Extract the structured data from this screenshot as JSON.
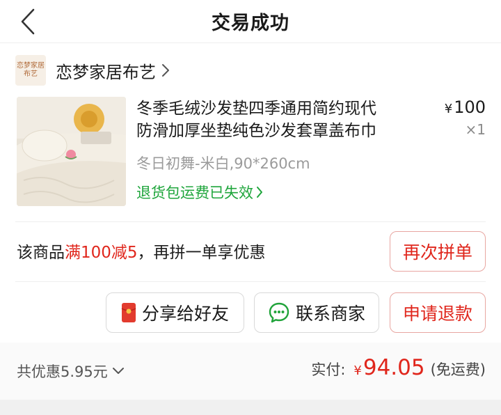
{
  "header": {
    "title": "交易成功",
    "back_icon": "chevron-left-icon"
  },
  "shop": {
    "logo_text": "恋梦家居布艺",
    "name": "恋梦家居布艺",
    "chevron_icon": "chevron-right-icon"
  },
  "product": {
    "title_line1": "冬季毛绒沙发垫四季通用简约现代",
    "title_line2": "防滑加厚坐垫纯色沙发套罩盖布巾",
    "price_symbol": "¥",
    "price": "100",
    "quantity": "×1",
    "sku": "冬日初舞-米白,90*260cm",
    "return_status": "退货包运费已失效"
  },
  "promo": {
    "prefix": "该商品",
    "highlight": "满100减5",
    "suffix": "，再拼一单享优惠",
    "button_label": "再次拼单"
  },
  "actions": {
    "share_label": "分享给好友",
    "share_icon": "red-envelope-icon",
    "contact_label": "联系商家",
    "contact_icon": "chat-bubble-icon",
    "refund_label": "申请退款"
  },
  "footer": {
    "discount_label": "共优惠5.95元",
    "paid_label": "实付:",
    "paid_symbol": "¥",
    "paid_amount": "94.05",
    "shipping_note": "(免运费)"
  },
  "colors": {
    "accent_red": "#e0261c",
    "success_green": "#1ea53b"
  }
}
